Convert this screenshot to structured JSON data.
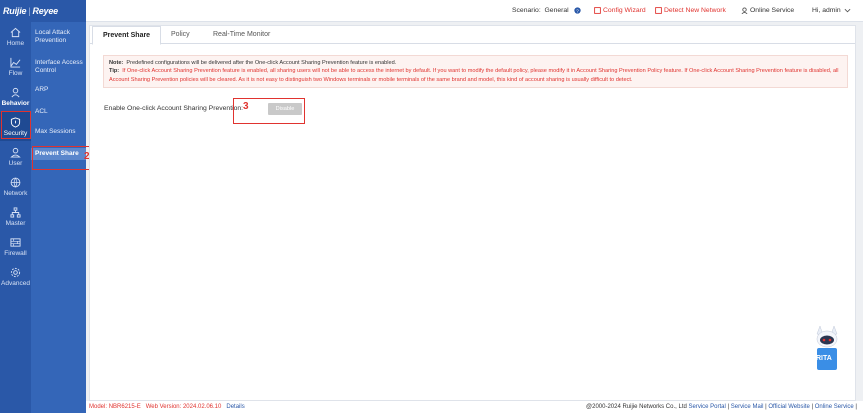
{
  "brand": {
    "logo_left": "Ruijie",
    "logo_right": "Reyee"
  },
  "nav": [
    {
      "label": "Home",
      "icon": "home-icon"
    },
    {
      "label": "Flow",
      "icon": "chart-icon"
    },
    {
      "label": "Behavior",
      "icon": "behavior-icon"
    },
    {
      "label": "Security",
      "icon": "shield-icon"
    },
    {
      "label": "User",
      "icon": "user-icon"
    },
    {
      "label": "Network",
      "icon": "globe-icon"
    },
    {
      "label": "Master",
      "icon": "topology-icon"
    },
    {
      "label": "Firewall",
      "icon": "firewall-icon"
    },
    {
      "label": "Advanced",
      "icon": "gear-icon"
    }
  ],
  "submenu": [
    {
      "label": "Local Attack Prevention"
    },
    {
      "label": "Interface Access Control"
    },
    {
      "label": "ARP"
    },
    {
      "label": "ACL"
    },
    {
      "label": "Max Sessions"
    },
    {
      "label": "Prevent Share"
    }
  ],
  "annotations": {
    "submenu": "2",
    "toggle": "3"
  },
  "topbar": {
    "scenario_label": "Scenario:",
    "scenario_value": "General",
    "config_wizard": "Config Wizard",
    "detect_network": "Detect New Network",
    "online_service": "Online Service",
    "user": "Hi, admin"
  },
  "tabs": [
    {
      "label": "Prevent Share"
    },
    {
      "label": "Policy"
    },
    {
      "label": "Real-Time Monitor"
    }
  ],
  "note": {
    "note_label": "Note:",
    "note_text": "Predefined configurations will be delivered after the One-click Account Sharing Prevention feature is enabled.",
    "tip_label": "Tip:",
    "tip_text": "If One-click Account Sharing Prevention feature is enabled, all sharing users will not be able to access the internet by default. If you want to modify the default policy, please modify it in Account Sharing Prevention Policy feature. If One-click Account Sharing Prevention feature is disabled, all Account Sharing Prevention policies will be cleared. As it is not easy to distinguish two Windows terminals or mobile terminals of the same brand and model, this kind of account sharing is usually difficult to detect."
  },
  "form": {
    "enable_label": "Enable One-click Account Sharing Prevention:",
    "toggle_text": "Disable"
  },
  "footer": {
    "model_label": "Model:",
    "model_value": "NBR6215-E",
    "web_label": "Web Version:",
    "web_value": "2024.02.06.10",
    "details": "Details",
    "copyright": "@2000-2024 Ruijie Networks Co., Ltd",
    "service_portal": "Service Portal",
    "service_mail": "Service Mail",
    "official_website": "Official Website",
    "online_service": "Online Service"
  },
  "assistant": {
    "label": "RITA"
  },
  "colors": {
    "sidebar": "#2a58a8",
    "submenu": "#3466b8",
    "accent_red": "#e0332f"
  }
}
